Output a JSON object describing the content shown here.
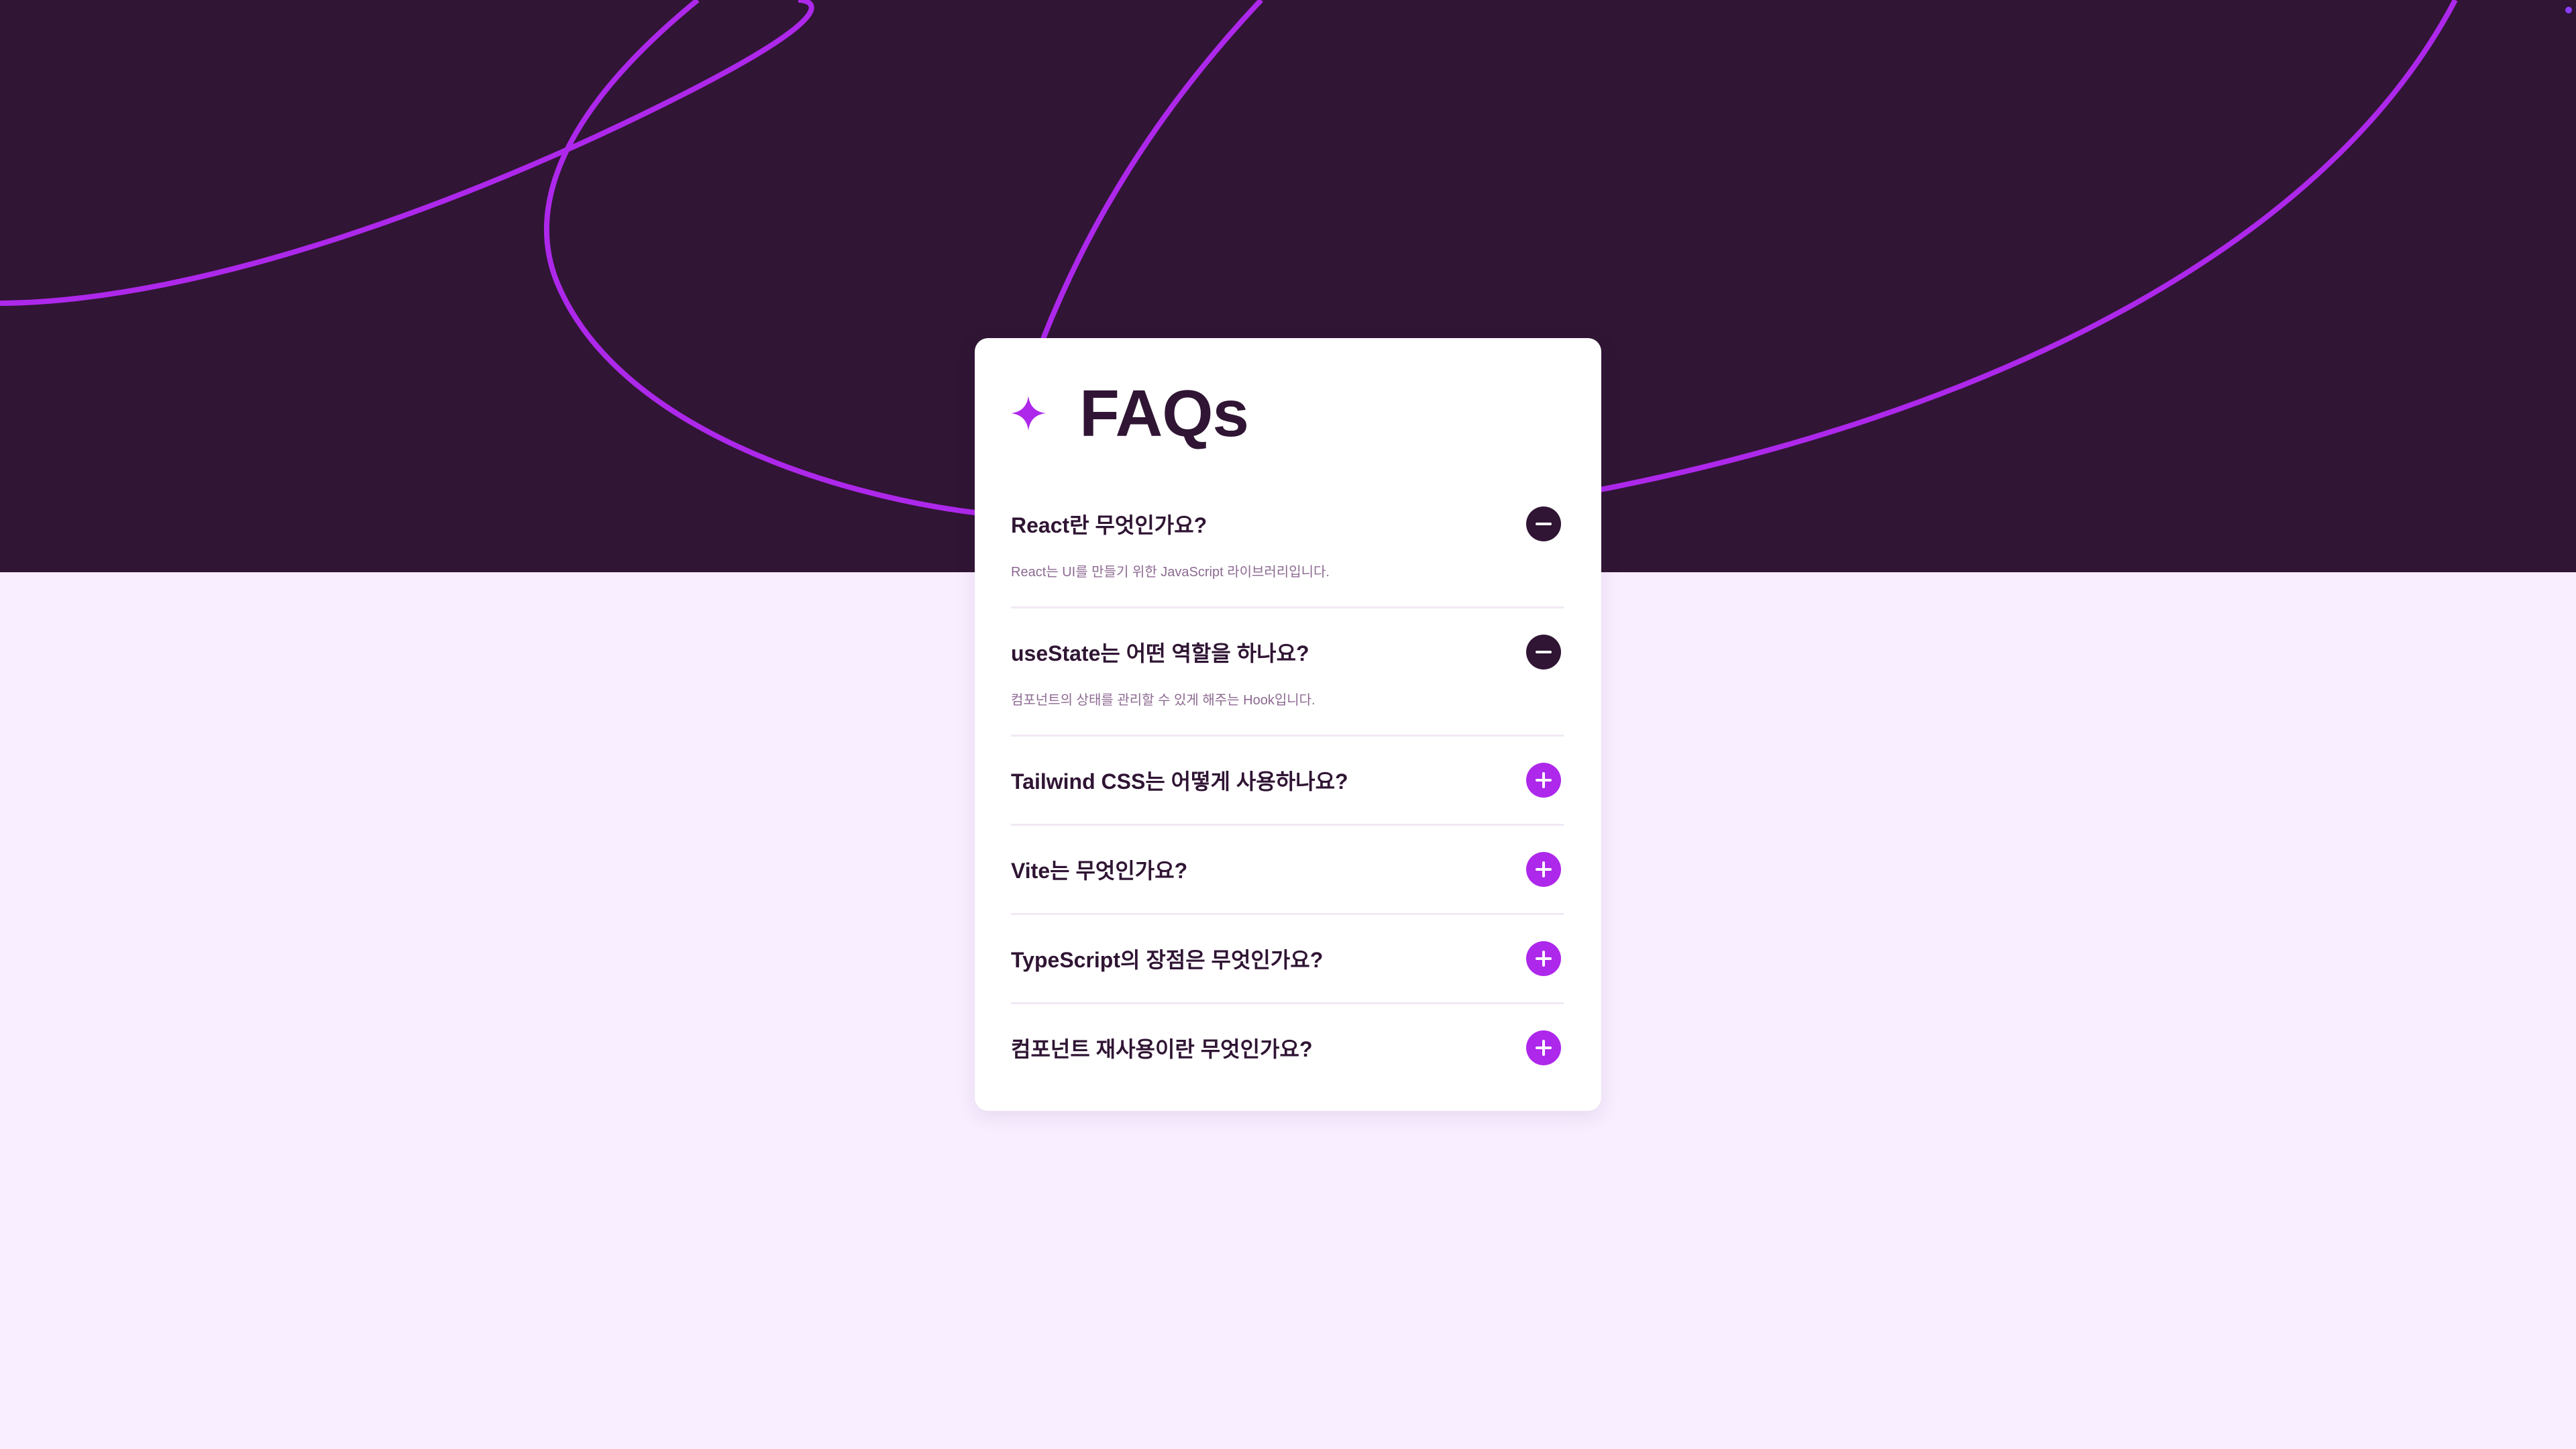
{
  "colors": {
    "hero_bg": "#301534",
    "page_bg": "#f8eeff",
    "accent": "#ad28eb",
    "dark": "#301534",
    "answer_text": "#8c6991"
  },
  "header": {
    "icon": "sparkle-star-icon",
    "title": "FAQs"
  },
  "faqs": [
    {
      "question": "React란 무엇인가요?",
      "answer": "React는 UI를 만들기 위한 JavaScript 라이브러리입니다.",
      "expanded": true,
      "toggle_icon": "minus-icon"
    },
    {
      "question": "useState는 어떤 역할을 하나요?",
      "answer": "컴포넌트의 상태를 관리할 수 있게 해주는 Hook입니다.",
      "expanded": true,
      "toggle_icon": "minus-icon"
    },
    {
      "question": "Tailwind CSS는 어떻게 사용하나요?",
      "expanded": false,
      "toggle_icon": "plus-icon"
    },
    {
      "question": "Vite는 무엇인가요?",
      "expanded": false,
      "toggle_icon": "plus-icon"
    },
    {
      "question": "TypeScript의 장점은 무엇인가요?",
      "expanded": false,
      "toggle_icon": "plus-icon"
    },
    {
      "question": "컴포넌트 재사용이란 무엇인가요?",
      "expanded": false,
      "toggle_icon": "plus-icon"
    }
  ]
}
